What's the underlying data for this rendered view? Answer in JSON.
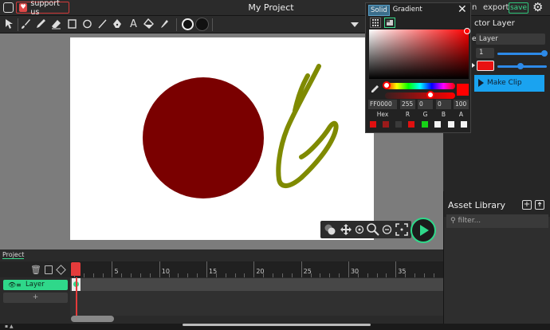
{
  "header": {
    "support_label": "support us",
    "title": "My Project",
    "right_fragment": "n",
    "export_label": "export",
    "save_label": "save"
  },
  "toolbar": {
    "tools": [
      "select-arrow-icon",
      "brush-icon",
      "pencil-icon",
      "eraser-icon",
      "rectangle-icon",
      "circle-icon",
      "line-icon",
      "pen-icon",
      "text-icon",
      "fill-bucket-icon",
      "eyedropper-icon"
    ],
    "text_tool_glyph": "A",
    "stroke_color": "#111111",
    "fill_color": "#111111"
  },
  "canvas": {
    "background": "#ffffff",
    "circle_color": "#7a0000",
    "stroke_color": "#7f8a00"
  },
  "color_picker": {
    "tabs": [
      "Solid",
      "Gradient"
    ],
    "hex": "FF0000",
    "r": "255",
    "g": "0",
    "b": "0",
    "a": "100",
    "labels": [
      "Hex",
      "R",
      "G",
      "B",
      "A"
    ],
    "current_color": "#ff0000",
    "swatches": [
      "#e01010",
      "#9b1a1a",
      "#3a3a3a",
      "#e01010",
      "#16d316",
      "#f4f4f4",
      "#f4f4f4",
      "#f4f4f4"
    ]
  },
  "properties": {
    "title_fragment": "ctor",
    "title_word": "Layer",
    "label_fragment": "e",
    "name_value": "Layer",
    "stroke_value": "1",
    "color": "#e81212",
    "make_clip_label": "Make Clip"
  },
  "assets": {
    "title": "Asset Library",
    "filter_placeholder": "filter..."
  },
  "timeline": {
    "tab_label": "Project",
    "layer_name": "Layer",
    "add_label": "+",
    "ticks": [
      "5",
      "10",
      "15",
      "20",
      "25",
      "30",
      "35"
    ]
  }
}
